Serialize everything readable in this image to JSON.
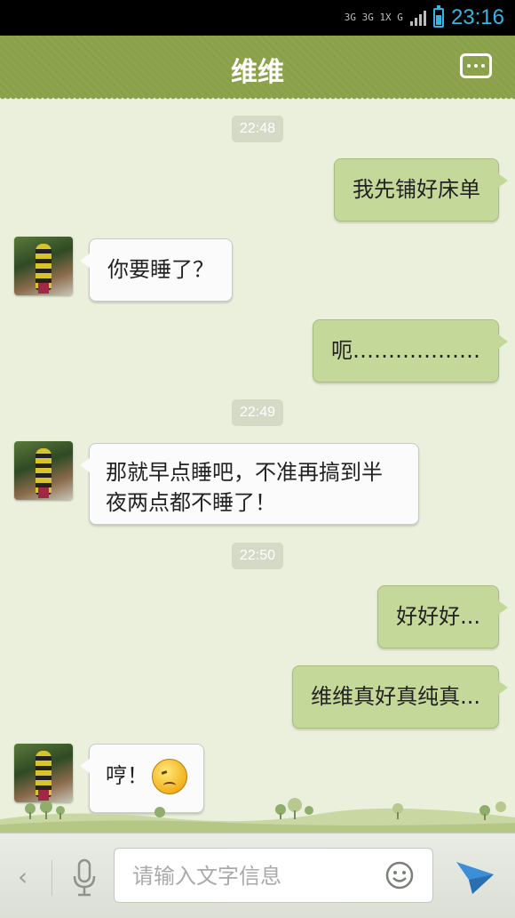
{
  "status_bar": {
    "network_top": "3G 3G 1X G",
    "time": "23:16",
    "battery_fraction": 0.6,
    "accent": "#31b6e7"
  },
  "header": {
    "title": "维维",
    "more_icon": "more-dots-icon",
    "bg": "#8aa14a"
  },
  "messages": [
    {
      "type": "time",
      "text": "22:48"
    },
    {
      "type": "out",
      "text": "我先铺好床单"
    },
    {
      "type": "in",
      "text": "你要睡了？"
    },
    {
      "type": "out",
      "text": "呃………………"
    },
    {
      "type": "time",
      "text": "22:49"
    },
    {
      "type": "in",
      "text": "那就早点睡吧，不准再搞到半夜两点都不睡了！"
    },
    {
      "type": "time",
      "text": "22:50"
    },
    {
      "type": "out",
      "text": "好好好..."
    },
    {
      "type": "out",
      "text": "维维真好真纯真..."
    },
    {
      "type": "in",
      "text": "哼！",
      "emoji": "sad-face-emoji"
    }
  ],
  "input_bar": {
    "placeholder": "请输入文字信息",
    "icons": [
      "back-chevron-icon",
      "microphone-icon",
      "smiley-icon",
      "send-icon"
    ]
  }
}
